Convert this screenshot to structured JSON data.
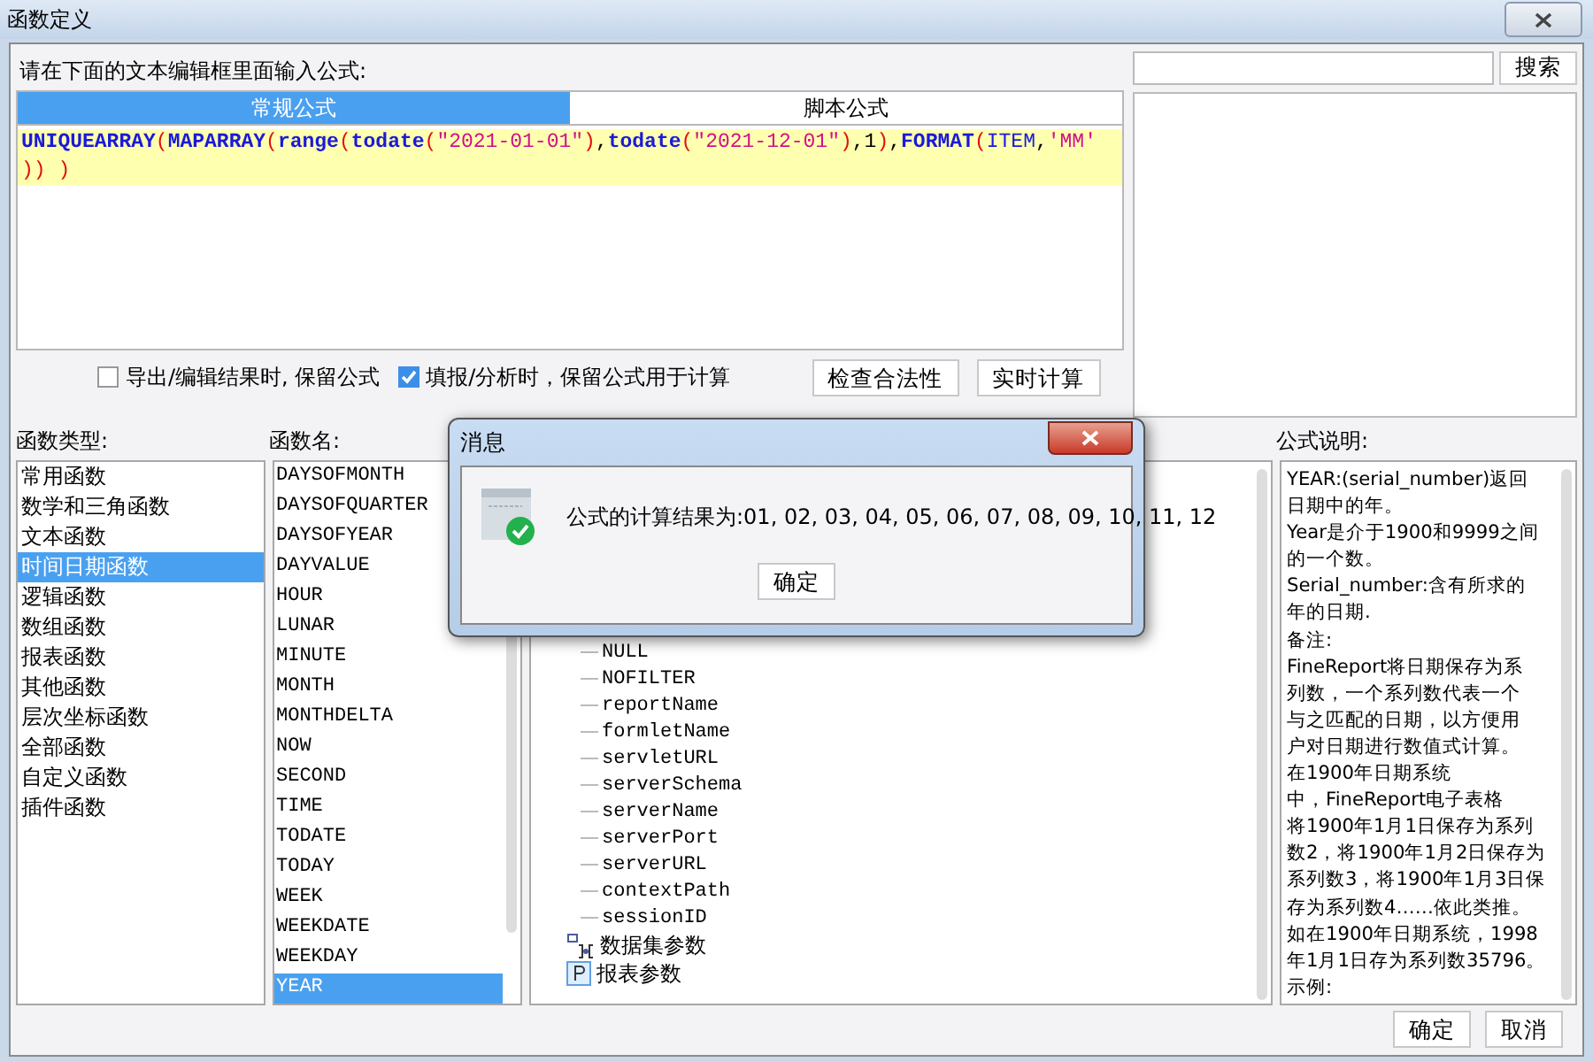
{
  "window": {
    "title": "函数定义"
  },
  "editor": {
    "prompt": "请在下面的文本编辑框里面输入公式:",
    "tabs": [
      {
        "label": "常规公式",
        "selected": true
      },
      {
        "label": "脚本公式",
        "selected": false
      }
    ],
    "formula_lines": [
      [
        {
          "kind": "func",
          "text": "UNIQUEARRAY"
        },
        {
          "kind": "paren",
          "text": "("
        },
        {
          "kind": "func",
          "text": "MAPARRAY"
        },
        {
          "kind": "paren",
          "text": "("
        },
        {
          "kind": "func",
          "text": "range"
        },
        {
          "kind": "paren",
          "text": "("
        },
        {
          "kind": "func",
          "text": "todate"
        },
        {
          "kind": "paren",
          "text": "("
        },
        {
          "kind": "string",
          "text": "\"2021-01-01\""
        },
        {
          "kind": "paren",
          "text": ")"
        },
        {
          "kind": "plain",
          "text": ","
        },
        {
          "kind": "func",
          "text": "todate"
        },
        {
          "kind": "paren",
          "text": "("
        },
        {
          "kind": "string",
          "text": "\"2021-12-01\""
        },
        {
          "kind": "paren",
          "text": ")"
        },
        {
          "kind": "plain",
          "text": ",1"
        },
        {
          "kind": "paren",
          "text": ")"
        },
        {
          "kind": "plain",
          "text": ","
        },
        {
          "kind": "func",
          "text": "FORMAT"
        },
        {
          "kind": "paren",
          "text": "("
        },
        {
          "kind": "field",
          "text": "ITEM"
        },
        {
          "kind": "plain",
          "text": ","
        },
        {
          "kind": "string",
          "text": "'MM'"
        }
      ],
      [
        {
          "kind": "paren",
          "text": "))"
        },
        {
          "kind": "paren",
          "text": " )"
        }
      ]
    ],
    "options": [
      {
        "label": "导出/编辑结果时, 保留公式",
        "checked": false
      },
      {
        "label": "填报/分析时，保留公式用于计算",
        "checked": true
      }
    ],
    "buttons": [
      "检查合法性",
      "实时计算"
    ]
  },
  "search": {
    "button": "搜索"
  },
  "function_types": {
    "label": "函数类型:",
    "items": [
      {
        "label": "常用函数",
        "selected": false
      },
      {
        "label": "数学和三角函数",
        "selected": false
      },
      {
        "label": "文本函数",
        "selected": false
      },
      {
        "label": "时间日期函数",
        "selected": true
      },
      {
        "label": "逻辑函数",
        "selected": false
      },
      {
        "label": "数组函数",
        "selected": false
      },
      {
        "label": "报表函数",
        "selected": false
      },
      {
        "label": "其他函数",
        "selected": false
      },
      {
        "label": "层次坐标函数",
        "selected": false
      },
      {
        "label": "全部函数",
        "selected": false
      },
      {
        "label": "自定义函数",
        "selected": false
      },
      {
        "label": "插件函数",
        "selected": false
      }
    ]
  },
  "function_names": {
    "label": "函数名:",
    "items": [
      {
        "label": "DAYSOFMONTH",
        "selected": false
      },
      {
        "label": "DAYSOFQUARTER",
        "selected": false
      },
      {
        "label": "DAYSOFYEAR",
        "selected": false
      },
      {
        "label": "DAYVALUE",
        "selected": false
      },
      {
        "label": "HOUR",
        "selected": false
      },
      {
        "label": "LUNAR",
        "selected": false
      },
      {
        "label": "MINUTE",
        "selected": false
      },
      {
        "label": "MONTH",
        "selected": false
      },
      {
        "label": "MONTHDELTA",
        "selected": false
      },
      {
        "label": "NOW",
        "selected": false
      },
      {
        "label": "SECOND",
        "selected": false
      },
      {
        "label": "TIME",
        "selected": false
      },
      {
        "label": "TODATE",
        "selected": false
      },
      {
        "label": "TODAY",
        "selected": false
      },
      {
        "label": "WEEK",
        "selected": false
      },
      {
        "label": "WEEKDATE",
        "selected": false
      },
      {
        "label": "WEEKDAY",
        "selected": false
      },
      {
        "label": "YEAR",
        "selected": true
      }
    ]
  },
  "parameter_tree": {
    "items": [
      {
        "label": "NULL",
        "kind": "leaf"
      },
      {
        "label": "NOFILTER",
        "kind": "leaf"
      },
      {
        "label": "reportName",
        "kind": "leaf"
      },
      {
        "label": "formletName",
        "kind": "leaf"
      },
      {
        "label": "servletURL",
        "kind": "leaf"
      },
      {
        "label": "serverSchema",
        "kind": "leaf"
      },
      {
        "label": "serverName",
        "kind": "leaf"
      },
      {
        "label": "serverPort",
        "kind": "leaf"
      },
      {
        "label": "serverURL",
        "kind": "leaf"
      },
      {
        "label": "contextPath",
        "kind": "leaf"
      },
      {
        "label": "sessionID",
        "kind": "leaf"
      },
      {
        "label": "数据集参数",
        "kind": "dataset"
      },
      {
        "label": "报表参数",
        "kind": "param"
      }
    ]
  },
  "description": {
    "label": "公式说明:",
    "lines": [
      "YEAR:(serial_number)返回",
      "日期中的年。",
      "Year是介于1900和9999之间",
      "的一个数。",
      "Serial_number:含有所求的",
      "年的日期.",
      "备注:",
      "FineReport将日期保存为系",
      "列数，一个系列数代表一个",
      "与之匹配的日期，以方便用",
      "户对日期进行数值式计算。",
      "在1900年日期系统",
      "中，FineReport电子表格",
      "将1900年1月1日保存为系列",
      "数2，将1900年1月2日保存为",
      "系列数3，将1900年1月3日保",
      "存为系列数4……依此类推。",
      "如在1900年日期系统，1998",
      "年1月1日存为系列数35796。",
      "示例:"
    ]
  },
  "footer_buttons": [
    "确定",
    "取消"
  ],
  "message_dialog": {
    "title": "消息",
    "text": "公式的计算结果为:01, 02, 03, 04, 05, 06, 07, 08, 09, 10, 11, 12",
    "button": "确定"
  }
}
